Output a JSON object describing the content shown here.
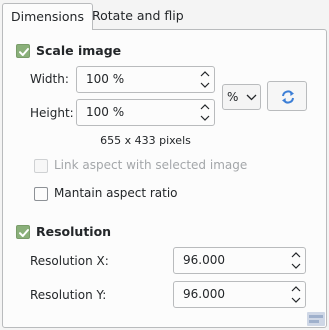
{
  "tabs": [
    {
      "label": "Dimensions",
      "active": true
    },
    {
      "label": "Rotate and flip",
      "active": false
    }
  ],
  "scale": {
    "checkbox_label": "Scale image",
    "checked": true,
    "width_label": "Width:",
    "width_value": "100 %",
    "height_label": "Height:",
    "height_value": "100 %",
    "unit_value": "%",
    "size_text": "655 x 433 pixels",
    "link_aspect_label": "Link aspect with selected image",
    "link_aspect_checked": false,
    "link_aspect_enabled": false,
    "maintain_aspect_label": "Mantain aspect ratio",
    "maintain_aspect_checked": false
  },
  "resolution": {
    "checkbox_label": "Resolution",
    "checked": true,
    "x_label": "Resolution X:",
    "x_value": "96.000",
    "y_label": "Resolution Y:",
    "y_value": "96.000"
  },
  "icons": {
    "swap": "swap-arrows-icon",
    "spin_up": "chevron-up-icon",
    "spin_down": "chevron-down-icon",
    "combo": "chevron-down-icon"
  },
  "colors": {
    "accent_check": "#8ab07a",
    "swap_icon": "#3d7fd6"
  }
}
